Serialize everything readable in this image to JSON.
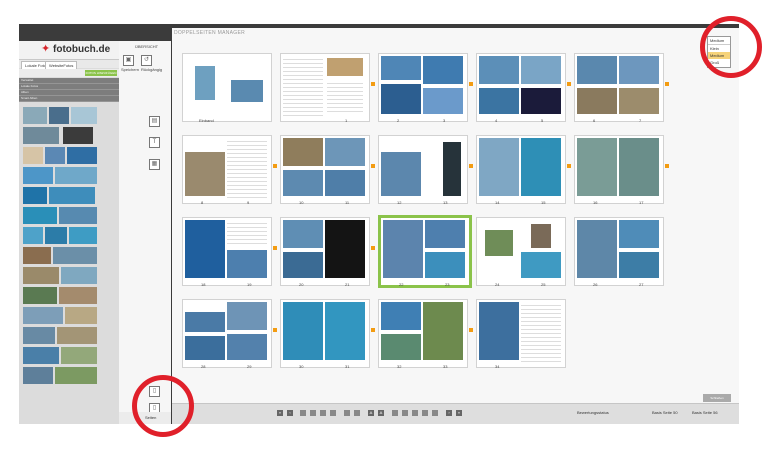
{
  "brand": {
    "name": "fotobuch.de"
  },
  "left_tabs": [
    "Lokale Fotos",
    "WebsiteFotos"
  ],
  "green_button": "FOTOS HINZUFÜGEN",
  "greybars": [
    "Verwaltet",
    "Lokale Fotos",
    "Alben",
    "Smart Alben"
  ],
  "sidebar_top": {
    "title": "ÜBERSICHT",
    "save": "Speichern",
    "undo": "Rückgängig"
  },
  "bottom_tabs": {
    "pages": "Seiten"
  },
  "main": {
    "title": "DOPPELSEITEN MANAGER",
    "apply_button": "Schließen",
    "zoom_label": "Bewertungsstatus",
    "bottom_right_a": "Basis Seite 50",
    "bottom_right_b": "Basis Seite 56"
  },
  "size_dropdown": {
    "header": "Medium",
    "options": [
      "Klein",
      "Medium",
      "Groß"
    ],
    "selected": "Medium"
  },
  "spreads": [
    {
      "labels": [
        "Einband",
        ""
      ]
    },
    {
      "labels": [
        "",
        "1"
      ]
    },
    {
      "labels": [
        "2",
        "3"
      ]
    },
    {
      "labels": [
        "4",
        "5"
      ]
    },
    {
      "labels": [
        "6",
        "7"
      ]
    },
    {
      "labels": [
        "8",
        "9"
      ]
    },
    {
      "labels": [
        "10",
        "11"
      ]
    },
    {
      "labels": [
        "12",
        "13"
      ]
    },
    {
      "labels": [
        "14",
        "15"
      ]
    },
    {
      "labels": [
        "16",
        "17"
      ]
    },
    {
      "labels": [
        "18",
        "19"
      ]
    },
    {
      "labels": [
        "20",
        "21"
      ]
    },
    {
      "labels": [
        "22",
        "23"
      ]
    },
    {
      "labels": [
        "24",
        "25"
      ]
    },
    {
      "labels": [
        "26",
        "27"
      ]
    },
    {
      "labels": [
        "28",
        "29"
      ]
    },
    {
      "labels": [
        "30",
        "31"
      ]
    },
    {
      "labels": [
        "32",
        "33"
      ]
    },
    {
      "labels": [
        "34",
        ""
      ]
    }
  ],
  "colors": {
    "highlight": "#e0202a",
    "selected": "#8bc34a",
    "marker": "#f39c12"
  }
}
